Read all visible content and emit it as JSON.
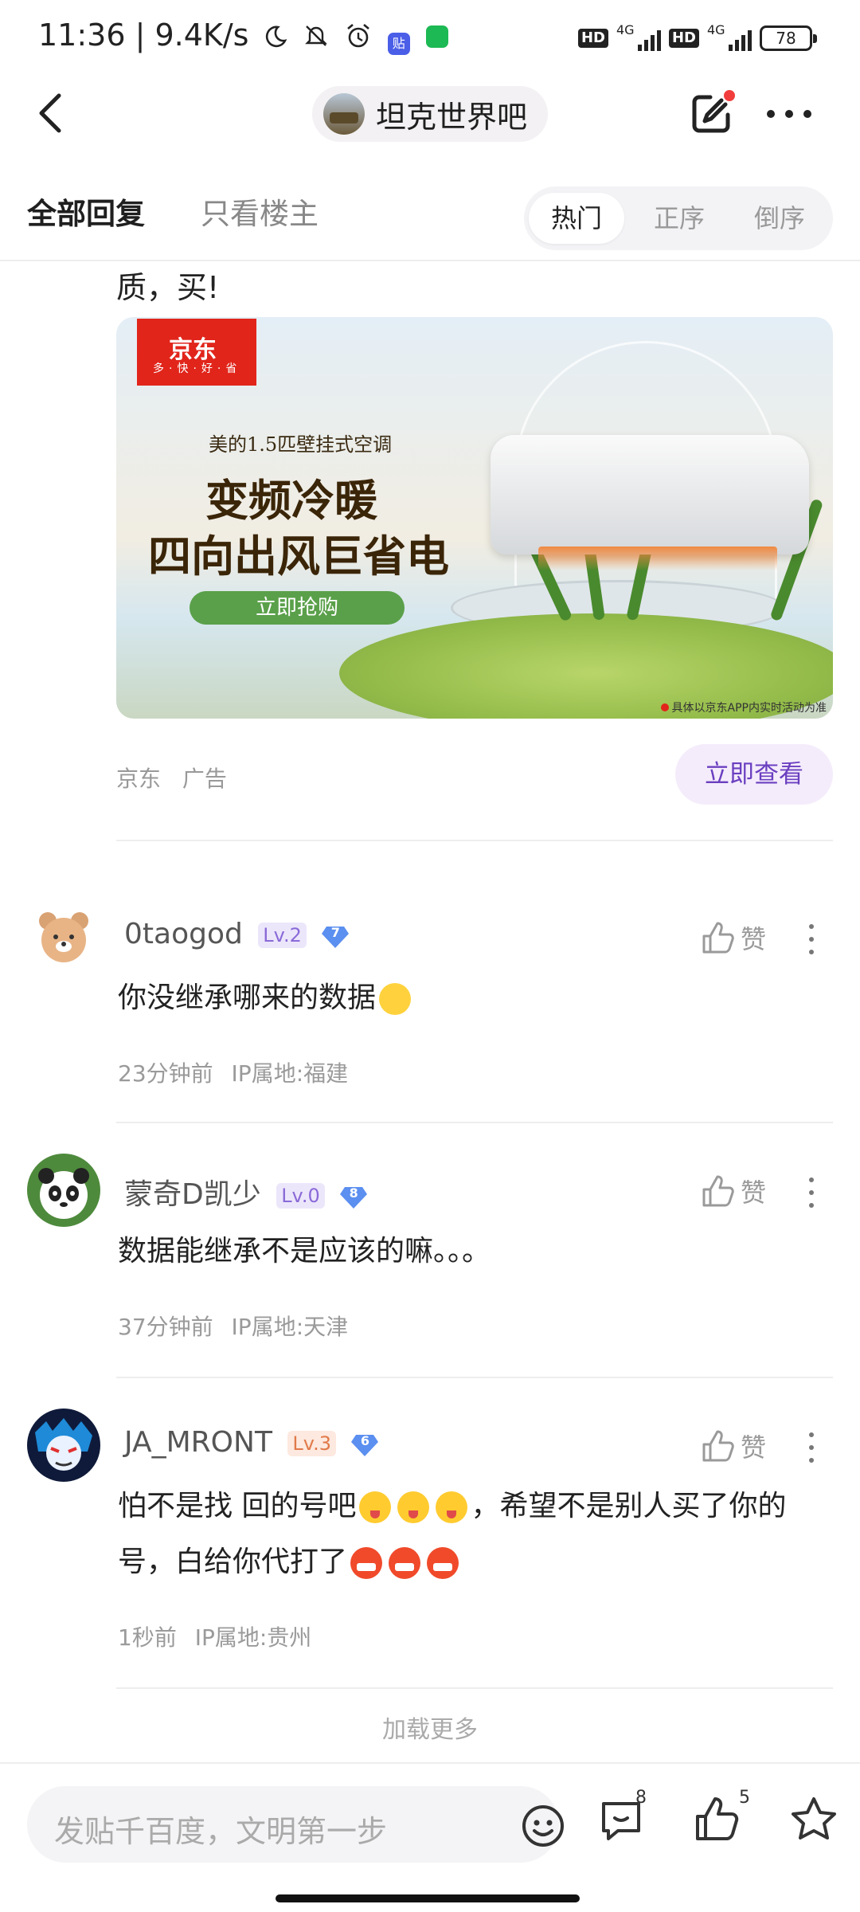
{
  "status_bar": {
    "time": "11:36 | 9.4K/s",
    "hd1": "HD",
    "net1": "4G",
    "hd2": "HD",
    "net2": "4G",
    "battery": "78"
  },
  "header": {
    "forum_name": "坦克世界吧"
  },
  "tabs": {
    "all_replies": "全部回复",
    "op_only": "只看楼主"
  },
  "sort": {
    "options": [
      "热门",
      "正序",
      "倒序"
    ],
    "selected": "热门"
  },
  "ad": {
    "preceding_text": "质，买!",
    "banner": {
      "brand_logo": "京东",
      "brand_slogan": "多·快·好·省",
      "subtitle": "美的1.5匹壁挂式空调",
      "headline1": "变频冷暖",
      "headline2": "四向出风巨省电",
      "cta": "立即抢购",
      "disclaimer": "具体以京东APP内实时活动为准"
    },
    "source": "京东",
    "label": "广告",
    "button": "立即查看"
  },
  "comments": [
    {
      "username": "0taogod",
      "level": "Lv.2",
      "badge": "7",
      "like_label": "赞",
      "text": "你没继承哪来的数据",
      "emojis": [
        "thinking-emoji"
      ],
      "time": "23分钟前",
      "ip": "IP属地:福建"
    },
    {
      "username": "蒙奇D凯少",
      "level": "Lv.0",
      "badge": "8",
      "like_label": "赞",
      "text": "数据能继承不是应该的嘛。。。",
      "time": "37分钟前",
      "ip": "IP属地:天津"
    },
    {
      "username": "JA_MRONT",
      "level": "Lv.3",
      "badge": "6",
      "like_label": "赞",
      "text_part1": "怕不是找 回的号吧",
      "text_part2": "，希望不是别人买了你的号，白给你代打了",
      "time": "1秒前",
      "ip": "IP属地:贵州"
    }
  ],
  "load_more": "加载更多",
  "bottom_bar": {
    "input_placeholder": "发贴千百度，文明第一步",
    "comment_count": "8",
    "like_count": "5"
  },
  "colors": {
    "accent_purple": "#6b3fc0",
    "lv2_bg": "#ece6fb",
    "lv0_bg": "#ece6fb",
    "lv3_bg": "#fde9df",
    "badge_blue": "#5b8ff0"
  }
}
